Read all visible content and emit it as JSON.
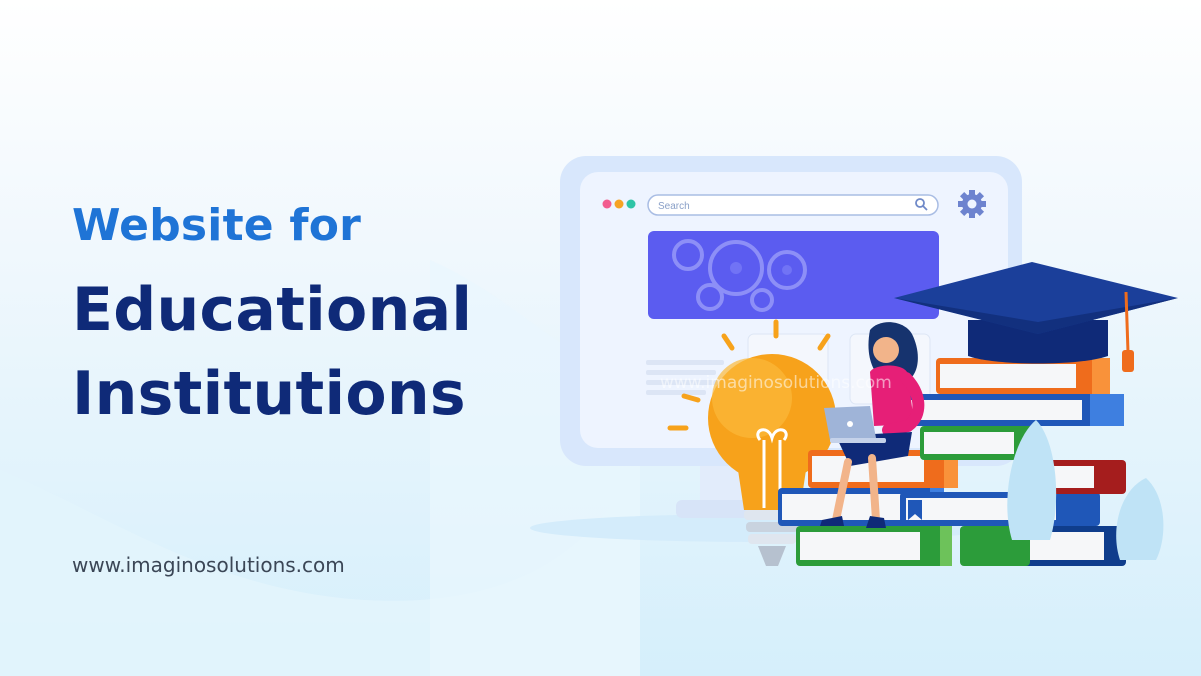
{
  "headline": {
    "line1": "Website for",
    "line2": "Educational",
    "line3": "Institutions"
  },
  "website_url": "www.imaginosolutions.com",
  "illustration": {
    "search_placeholder": "Search",
    "watermark": "www.imaginosolutions.com"
  },
  "icons": [
    "gear-icon",
    "search-icon",
    "light-bulb-icon",
    "graduation-cap-icon",
    "laptop-icon",
    "book-stack-icon",
    "browser-window-icon"
  ],
  "colors": {
    "headline_primary": "#1f74d6",
    "headline_secondary": "#0f2a78",
    "url_text": "#3b4656",
    "banner": "#5b5cf0",
    "bulb": "#f7a21b"
  }
}
